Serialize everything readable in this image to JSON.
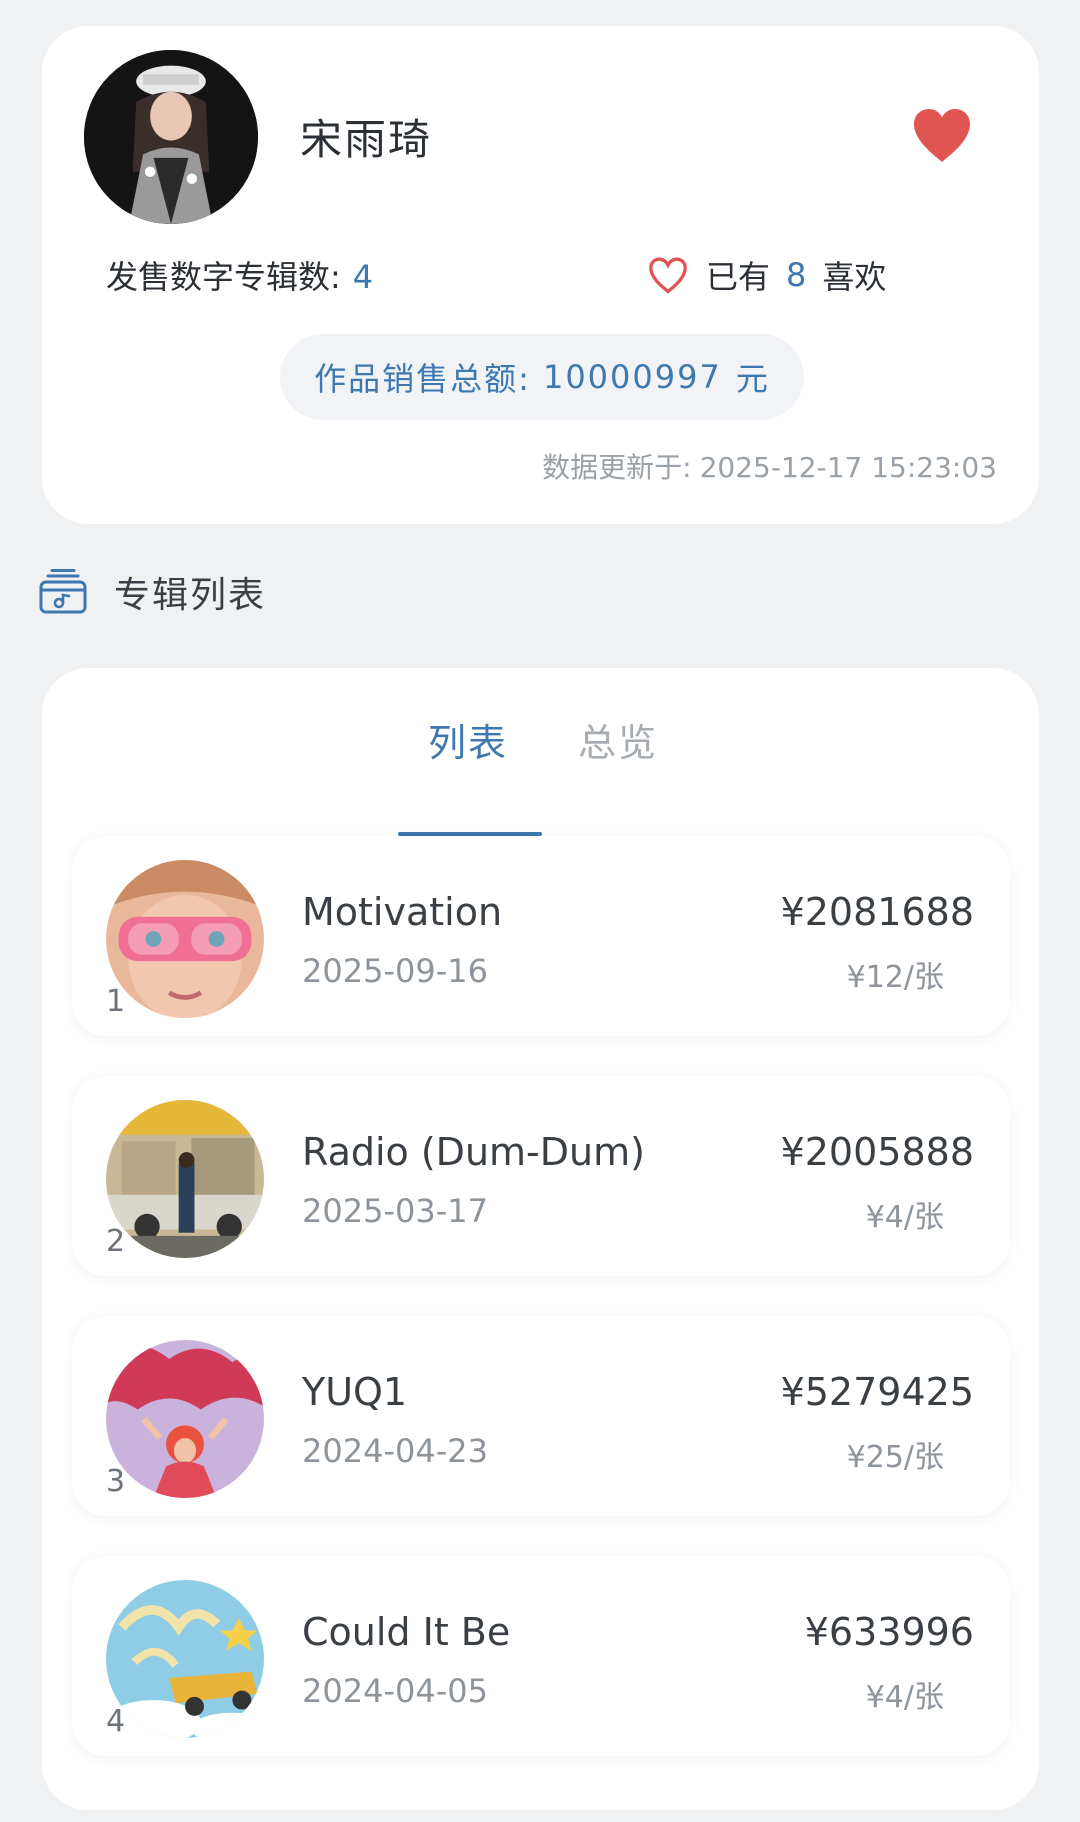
{
  "artist": {
    "name": "宋雨琦",
    "albums_label": "发售数字专辑数:",
    "albums_count": "4",
    "likes_prefix": "已有",
    "likes_count": "8",
    "likes_suffix": "喜欢",
    "sales_label": "作品销售总额:",
    "sales_value": "10000997",
    "sales_unit": "元",
    "updated_label": "数据更新于:",
    "updated_value": "2025-12-17 15:23:03",
    "favorite_color": "#e05552"
  },
  "section": {
    "title": "专辑列表",
    "icon": "album-list-icon"
  },
  "tabs": [
    {
      "label": "列表",
      "active": true
    },
    {
      "label": "总览",
      "active": false
    }
  ],
  "albums": [
    {
      "rank": "1",
      "title": "Motivation",
      "date": "2025-09-16",
      "sales": "¥2081688",
      "price": "¥12/张"
    },
    {
      "rank": "2",
      "title": "Radio (Dum-Dum)",
      "date": "2025-03-17",
      "sales": "¥2005888",
      "price": "¥4/张"
    },
    {
      "rank": "3",
      "title": "YUQ1",
      "date": "2024-04-23",
      "sales": "¥5279425",
      "price": "¥25/张"
    },
    {
      "rank": "4",
      "title": "Could It Be",
      "date": "2024-04-05",
      "sales": "¥633996",
      "price": "¥4/张"
    }
  ],
  "colors": {
    "accent": "#3d78b0",
    "background": "#f0f1f3"
  }
}
